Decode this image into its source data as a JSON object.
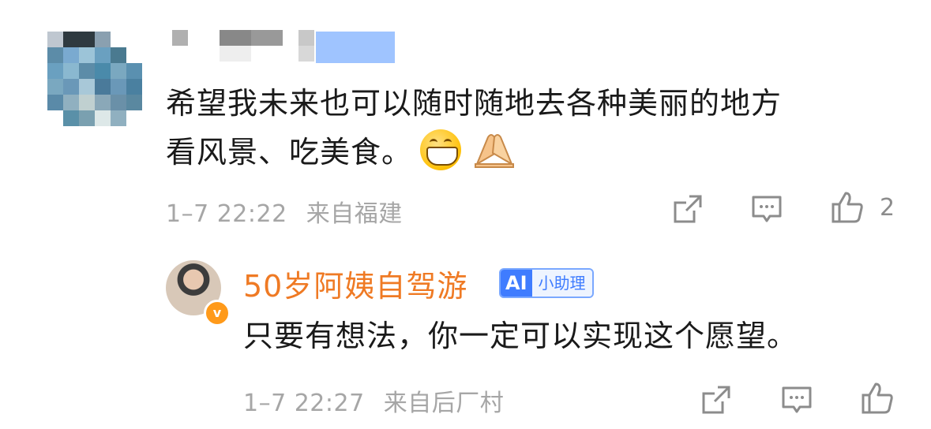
{
  "comment": {
    "text_line1": "希望我未来也可以随时随地去各种美丽的地方",
    "text_line2": "看风景、吃美食。",
    "emojis": [
      "grinning-face",
      "folded-hands"
    ],
    "timestamp": "1–7 22:22",
    "location": "来自福建",
    "like_count": "2"
  },
  "reply": {
    "author": "50岁阿姨自驾游",
    "badge_ai": "AI",
    "badge_label": "小助理",
    "verified_mark": "v",
    "text": "只要有想法，你一定可以实现这个愿望。",
    "timestamp": "1–7 22:27",
    "location": "来自后厂村"
  },
  "colors": {
    "author_name": "#ef7a24",
    "meta_text": "#a6a6a6",
    "badge_blue": "#3f7cff",
    "verify_orange": "#ff9a1a"
  }
}
